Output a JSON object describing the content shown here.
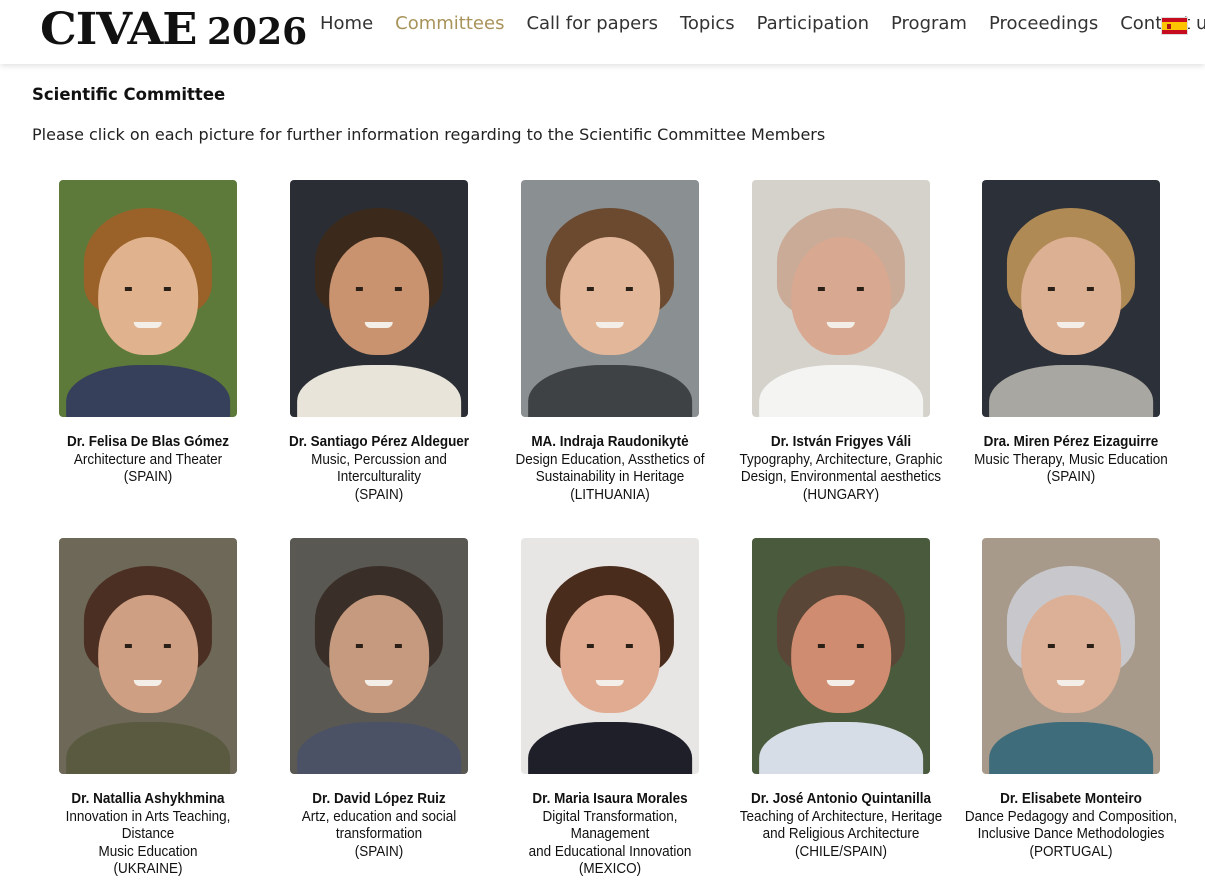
{
  "header": {
    "logo_text": "CIVAE",
    "logo_year": "2026",
    "nav": [
      "Home",
      "Committees",
      "Call for papers",
      "Topics",
      "Participation",
      "Program",
      "Proceedings",
      "Contact us"
    ],
    "active_nav": "Committees",
    "language_flag": "spain-flag-icon"
  },
  "main": {
    "title": "Scientific Committee",
    "intro": "Please click on each picture for further information regarding to the Scientific Committee Members",
    "members": [
      {
        "name": "Dr. Felisa De Blas Gómez",
        "field": "Architecture and Theater",
        "field2": "",
        "field3": "",
        "country": "(SPAIN)",
        "colors": {
          "bg": "#5d7a3a",
          "hair": "#9a6228",
          "skin": "#e1b28e",
          "body": "#36405a"
        }
      },
      {
        "name": "Dr. Santiago Pérez Aldeguer",
        "field": "Music, Percussion and Interculturality",
        "field2": "",
        "field3": "",
        "country": "(SPAIN)",
        "colors": {
          "bg": "#2a2e34",
          "hair": "#3b2a1c",
          "skin": "#c99370",
          "body": "#e8e4da"
        }
      },
      {
        "name": "MA. Indraja Raudonikytė",
        "field": "Design Education, Assthetics of",
        "field2": "Sustainability in Heritage",
        "field3": "",
        "country": "(LITHUANIA)",
        "colors": {
          "bg": "#8a8f92",
          "hair": "#6b4a30",
          "skin": "#e3b79a",
          "body": "#3f4244"
        }
      },
      {
        "name": "Dr. István Frigyes Váli",
        "field": "Typography, Architecture, Graphic",
        "field2": "Design, Environmental aesthetics",
        "field3": "",
        "country": "(HUNGARY)",
        "colors": {
          "bg": "#d5d2cc",
          "hair": "#c9ab98",
          "skin": "#d8a890",
          "body": "#f4f4f2"
        }
      },
      {
        "name": "Dra. Miren Pérez Eizaguirre",
        "field": "Music Therapy, Music Education",
        "field2": "",
        "field3": "",
        "country": "(SPAIN)",
        "colors": {
          "bg": "#2c3038",
          "hair": "#b08a55",
          "skin": "#dcb093",
          "body": "#a9a7a2"
        }
      },
      {
        "name": "Dr. Natallia Ashykhmina",
        "field": "Innovation in Arts Teaching, Distance",
        "field2": "Music Education",
        "field3": "",
        "country": "(UKRAINE)",
        "colors": {
          "bg": "#6e6858",
          "hair": "#4a2f22",
          "skin": "#cf9f84",
          "body": "#5a5a40"
        }
      },
      {
        "name": "Dr. David López Ruiz",
        "field": "Artz, education and social",
        "field2": "transformation",
        "field3": "",
        "country": "(SPAIN)",
        "colors": {
          "bg": "#5a5853",
          "hair": "#3a2f28",
          "skin": "#c69a7e",
          "body": "#4c5266"
        }
      },
      {
        "name": "Dr. Maria Isaura Morales",
        "field": "Digital Transformation, Management",
        "field2": "and Educational Innovation",
        "field3": "",
        "country": "(MEXICO)",
        "colors": {
          "bg": "#e8e6e4",
          "hair": "#4a2c1c",
          "skin": "#e0ab90",
          "body": "#1f1f2a"
        }
      },
      {
        "name": "Dr. José Antonio Quintanilla",
        "field": "Teaching of Architecture, Heritage",
        "field2": "and Religious Architecture",
        "field3": "",
        "country": "(CHILE/SPAIN)",
        "colors": {
          "bg": "#4a5a3c",
          "hair": "#5a4636",
          "skin": "#d08c70",
          "body": "#d6dde6"
        }
      },
      {
        "name": "Dr. Elisabete Monteiro",
        "field": "Dance Pedagogy and Composition,",
        "field2": "Inclusive Dance Methodologies",
        "field3": "",
        "country": "(PORTUGAL)",
        "colors": {
          "bg": "#a89a8a",
          "hair": "#c8c8cc",
          "skin": "#dcb096",
          "body": "#3f6c7a"
        }
      }
    ]
  }
}
